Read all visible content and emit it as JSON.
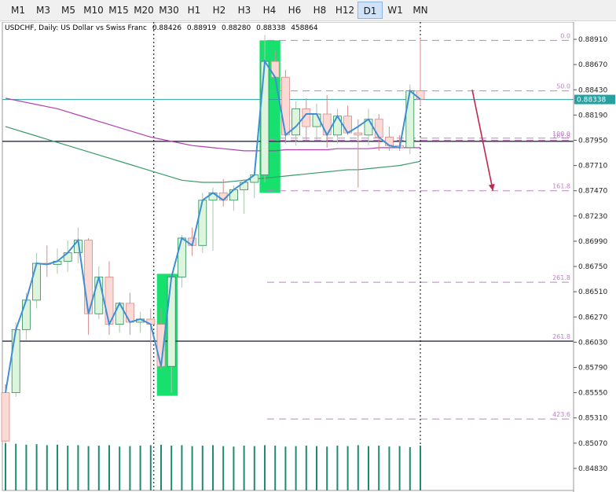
{
  "toolbar": {
    "timeframes": [
      "M1",
      "M3",
      "M5",
      "M10",
      "M15",
      "M20",
      "M30",
      "H1",
      "H2",
      "H3",
      "H4",
      "H6",
      "H8",
      "H12",
      "D1",
      "W1",
      "MN"
    ],
    "active": "D1"
  },
  "symbol_info": {
    "title": "USDCHF, Daily:  US Dollar vs Swiss Franc",
    "open": "0.88426",
    "high": "0.88919",
    "low": "0.88280",
    "close": "0.88338",
    "volume": "458864"
  },
  "colors": {
    "bull_body": "#ddf5dd",
    "bear_body": "#fbd9d5",
    "bull_edge": "#2e8b57",
    "bear_edge": "#d98a8a",
    "wick": "#a8c8a8",
    "zigzag": "#3d8fd6",
    "ma_fast": "#b040b0",
    "ma_slow": "#3a9a6a",
    "highlight": "#18e06e",
    "fib": "#c080c8",
    "arrow": "#c02850",
    "volume": "#1f8a70",
    "bid_line": "#26a0a0",
    "hline": "#2a2a44"
  },
  "chart_data": {
    "type": "candlestick",
    "title": "USDCHF, Daily:  US Dollar vs Swiss Franc",
    "ylim": [
      0.8474,
      0.8897
    ],
    "y_ticks": [
      "0.88910",
      "0.88670",
      "0.88430",
      "0.88190",
      "0.87950",
      "0.87710",
      "0.87470",
      "0.87230",
      "0.86990",
      "0.86750",
      "0.86510",
      "0.86270",
      "0.86030",
      "0.85790",
      "0.85550",
      "0.85310",
      "0.85070",
      "0.84830"
    ],
    "current_price": "0.88338",
    "candles": [
      {
        "o": 0.8555,
        "h": 0.8563,
        "l": 0.8507,
        "c": 0.8509
      },
      {
        "o": 0.8555,
        "h": 0.8622,
        "l": 0.8551,
        "c": 0.8615
      },
      {
        "o": 0.8615,
        "h": 0.865,
        "l": 0.8605,
        "c": 0.8643
      },
      {
        "o": 0.8643,
        "h": 0.8688,
        "l": 0.8635,
        "c": 0.8678
      },
      {
        "o": 0.8678,
        "h": 0.8695,
        "l": 0.8665,
        "c": 0.8677
      },
      {
        "o": 0.8677,
        "h": 0.8692,
        "l": 0.8668,
        "c": 0.868
      },
      {
        "o": 0.868,
        "h": 0.87,
        "l": 0.867,
        "c": 0.8688
      },
      {
        "o": 0.8688,
        "h": 0.8712,
        "l": 0.8678,
        "c": 0.87
      },
      {
        "o": 0.87,
        "h": 0.8702,
        "l": 0.861,
        "c": 0.863
      },
      {
        "o": 0.863,
        "h": 0.8675,
        "l": 0.8625,
        "c": 0.8665
      },
      {
        "o": 0.8665,
        "h": 0.868,
        "l": 0.861,
        "c": 0.862
      },
      {
        "o": 0.862,
        "h": 0.864,
        "l": 0.8612,
        "c": 0.864
      },
      {
        "o": 0.864,
        "h": 0.865,
        "l": 0.861,
        "c": 0.8622
      },
      {
        "o": 0.8622,
        "h": 0.8632,
        "l": 0.8612,
        "c": 0.8625
      },
      {
        "o": 0.8625,
        "h": 0.8635,
        "l": 0.8548,
        "c": 0.862
      },
      {
        "o": 0.862,
        "h": 0.8635,
        "l": 0.8577,
        "c": 0.858
      },
      {
        "o": 0.858,
        "h": 0.8668,
        "l": 0.8555,
        "c": 0.8665
      },
      {
        "o": 0.8665,
        "h": 0.8705,
        "l": 0.8655,
        "c": 0.8702
      },
      {
        "o": 0.8702,
        "h": 0.8712,
        "l": 0.8685,
        "c": 0.8695
      },
      {
        "o": 0.8695,
        "h": 0.8745,
        "l": 0.8688,
        "c": 0.8738
      },
      {
        "o": 0.8738,
        "h": 0.875,
        "l": 0.869,
        "c": 0.8745
      },
      {
        "o": 0.8745,
        "h": 0.8758,
        "l": 0.8732,
        "c": 0.8738
      },
      {
        "o": 0.8738,
        "h": 0.8752,
        "l": 0.8728,
        "c": 0.8748
      },
      {
        "o": 0.8748,
        "h": 0.8758,
        "l": 0.8725,
        "c": 0.8755
      },
      {
        "o": 0.8755,
        "h": 0.8765,
        "l": 0.874,
        "c": 0.8762
      },
      {
        "o": 0.8762,
        "h": 0.8895,
        "l": 0.8755,
        "c": 0.887
      },
      {
        "o": 0.887,
        "h": 0.888,
        "l": 0.885,
        "c": 0.8855
      },
      {
        "o": 0.8855,
        "h": 0.8862,
        "l": 0.8792,
        "c": 0.88
      },
      {
        "o": 0.88,
        "h": 0.8832,
        "l": 0.879,
        "c": 0.8825
      },
      {
        "o": 0.8825,
        "h": 0.8835,
        "l": 0.8795,
        "c": 0.8808
      },
      {
        "o": 0.8808,
        "h": 0.883,
        "l": 0.8795,
        "c": 0.882
      },
      {
        "o": 0.882,
        "h": 0.8838,
        "l": 0.8788,
        "c": 0.88
      },
      {
        "o": 0.88,
        "h": 0.8825,
        "l": 0.8792,
        "c": 0.8818
      },
      {
        "o": 0.8818,
        "h": 0.8828,
        "l": 0.88,
        "c": 0.8802
      },
      {
        "o": 0.8802,
        "h": 0.8815,
        "l": 0.875,
        "c": 0.88
      },
      {
        "o": 0.88,
        "h": 0.8825,
        "l": 0.879,
        "c": 0.8815
      },
      {
        "o": 0.8815,
        "h": 0.882,
        "l": 0.8785,
        "c": 0.8798
      },
      {
        "o": 0.8798,
        "h": 0.8808,
        "l": 0.8785,
        "c": 0.879
      },
      {
        "o": 0.879,
        "h": 0.88,
        "l": 0.8785,
        "c": 0.8788
      },
      {
        "o": 0.8788,
        "h": 0.8848,
        "l": 0.8782,
        "c": 0.8842
      },
      {
        "o": 0.8842,
        "h": 0.8892,
        "l": 0.8828,
        "c": 0.8834
      }
    ],
    "zigzag": [
      0.8555,
      0.8615,
      0.8643,
      0.8678,
      0.8677,
      0.868,
      0.8688,
      0.87,
      0.863,
      0.8665,
      0.862,
      0.864,
      0.8622,
      0.8625,
      0.862,
      0.858,
      0.8665,
      0.8702,
      0.8695,
      0.8738,
      0.8745,
      0.8738,
      0.8748,
      0.8755,
      0.8762,
      0.887,
      0.8855,
      0.88,
      0.8808,
      0.882,
      0.882,
      0.88,
      0.8818,
      0.8802,
      0.8808,
      0.8815,
      0.8798,
      0.879,
      0.8788,
      0.8842,
      0.8834
    ],
    "ma_fast": [
      0.8835,
      0.8833,
      0.8831,
      0.8829,
      0.8827,
      0.8825,
      0.8822,
      0.8819,
      0.8816,
      0.8813,
      0.881,
      0.8807,
      0.8804,
      0.8801,
      0.8798,
      0.8796,
      0.8794,
      0.8792,
      0.879,
      0.8789,
      0.8788,
      0.8787,
      0.8786,
      0.8785,
      0.8785,
      0.8785,
      0.8785,
      0.8786,
      0.8786,
      0.8786,
      0.8786,
      0.8786,
      0.8787,
      0.8787,
      0.8787,
      0.8787,
      0.8788,
      0.8788,
      0.8788,
      0.8788,
      0.8788
    ],
    "ma_slow": [
      0.8808,
      0.8805,
      0.8802,
      0.8799,
      0.8796,
      0.8793,
      0.879,
      0.8787,
      0.8784,
      0.8781,
      0.8778,
      0.8775,
      0.8772,
      0.8769,
      0.8766,
      0.8763,
      0.876,
      0.8757,
      0.8756,
      0.8755,
      0.8755,
      0.8755,
      0.8756,
      0.8757,
      0.8758,
      0.8759,
      0.876,
      0.8761,
      0.8762,
      0.8763,
      0.8764,
      0.8765,
      0.8766,
      0.8767,
      0.8767,
      0.8768,
      0.8769,
      0.877,
      0.8771,
      0.8773,
      0.8775
    ],
    "volumes": [
      1.0,
      0.99,
      0.97,
      0.98,
      0.96,
      0.97,
      0.95,
      0.96,
      0.94,
      0.95,
      0.96,
      0.93,
      0.94,
      0.95,
      0.96,
      0.97,
      0.95,
      0.96,
      0.94,
      0.95,
      0.96,
      0.94,
      0.93,
      0.95,
      0.94,
      0.96,
      0.95,
      0.93,
      0.94,
      0.95,
      0.94,
      0.93,
      0.95,
      0.94,
      0.96,
      0.94,
      0.95,
      0.93,
      0.94,
      0.92,
      0.95
    ],
    "horizontal_lines": [
      0.8794,
      0.8604
    ],
    "fib_levels": [
      {
        "label": "0.0",
        "price": 0.889
      },
      {
        "label": "50.0",
        "price": 0.8842
      },
      {
        "label": "100.0",
        "price": 0.8797
      },
      {
        "label": "161.8",
        "price": 0.8795
      },
      {
        "label": "161.8",
        "price": 0.8747
      },
      {
        "label": "261.8",
        "price": 0.866
      },
      {
        "label": "261.8",
        "price": 0.8604
      },
      {
        "label": "423.6",
        "price": 0.853
      }
    ],
    "highlight_boxes": [
      {
        "from_index": 14.6,
        "to_index": 16.6,
        "top": 0.8668,
        "bottom": 0.8552
      },
      {
        "from_index": 24.5,
        "to_index": 26.5,
        "top": 0.889,
        "bottom": 0.8745
      }
    ],
    "vertical_dotted_lines": [
      14.3,
      40.0
    ],
    "arrow": {
      "from_index": 45.0,
      "from_price": 0.8843,
      "to_index": 47.0,
      "to_price": 0.8747
    }
  }
}
